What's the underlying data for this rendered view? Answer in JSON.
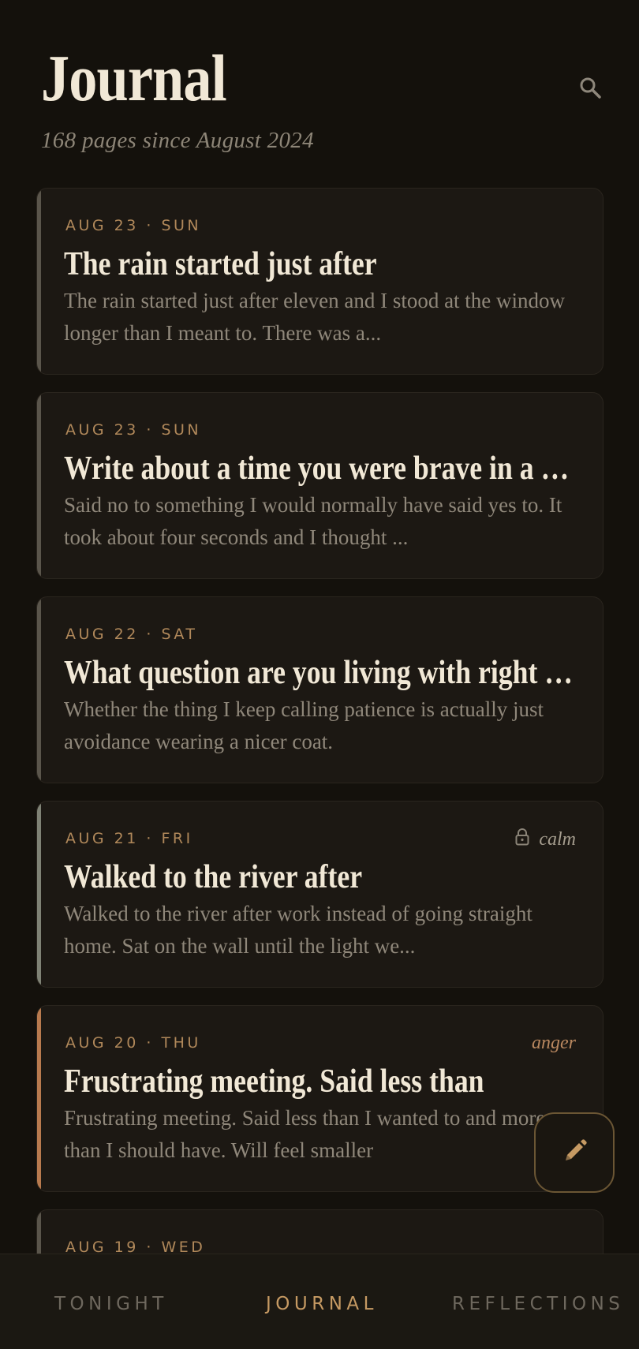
{
  "header": {
    "title": "Journal",
    "subtitle": "168 pages since August 2024",
    "search_icon": "search-icon"
  },
  "entries": [
    {
      "meta": "AUG 23 · SUN",
      "title": "The rain started just after",
      "excerpt": "The rain started just after eleven and I stood at the window longer than I meant to. There was a...",
      "mood": "",
      "locked": false,
      "accent": "none"
    },
    {
      "meta": "AUG 23 · SUN",
      "title": "Write about a time you were brave in a smal...",
      "excerpt": "Said no to something I would normally have said yes to. It took about four seconds and I thought ...",
      "mood": "",
      "locked": false,
      "accent": "none"
    },
    {
      "meta": "AUG 22 · SAT",
      "title": "What question are you living with right now?",
      "excerpt": "Whether the thing I keep calling patience is actually just avoidance wearing a nicer coat.",
      "mood": "",
      "locked": false,
      "accent": "none"
    },
    {
      "meta": "AUG 21 · FRI",
      "title": "Walked to the river after",
      "excerpt": "Walked to the river after work instead of going straight home. Sat on the wall until the light we...",
      "mood": "calm",
      "locked": true,
      "accent": "calm"
    },
    {
      "meta": "AUG 20 · THU",
      "title": "Frustrating meeting. Said less than",
      "excerpt": "Frustrating meeting. Said less than I wanted to and more than I should have. Will feel smaller",
      "mood": "anger",
      "locked": false,
      "accent": "anger"
    },
    {
      "meta": "AUG 19 · WED",
      "title": "",
      "excerpt": "",
      "mood": "",
      "locked": false,
      "accent": "none"
    }
  ],
  "fab": {
    "icon": "pencil-icon"
  },
  "tabs": [
    {
      "label": "TONIGHT",
      "active": false
    },
    {
      "label": "JOURNAL",
      "active": true
    },
    {
      "label": "REFLECTIONS",
      "active": false
    }
  ],
  "colors": {
    "background": "#14110c",
    "card": "#1c1813",
    "accent_gold": "#c69a63",
    "anger": "#b87a4e",
    "calm": "#7f8275"
  }
}
